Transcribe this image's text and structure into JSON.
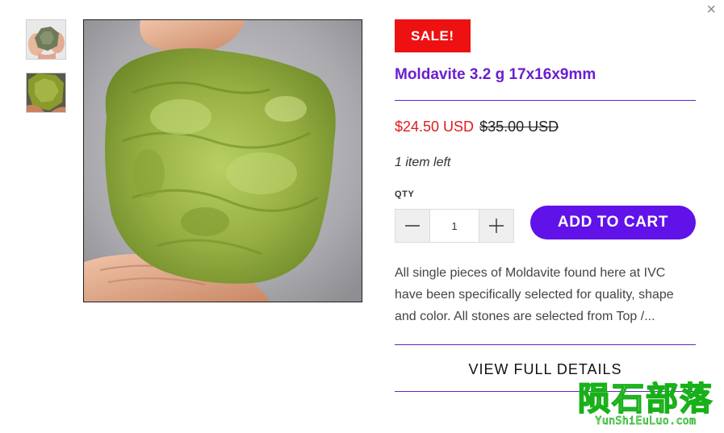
{
  "modal": {
    "close_label": "×"
  },
  "gallery": {
    "thumbnails": [
      {
        "alt": "Moldavite held between fingers, side view",
        "icon": "product-thumbnail"
      },
      {
        "alt": "Moldavite held between fingers, front view",
        "icon": "product-thumbnail"
      }
    ],
    "main_image_icon": "product-photo"
  },
  "product": {
    "badge": "SALE!",
    "title": "Moldavite 3.2 g 17x16x9mm",
    "price": "$24.50 USD",
    "compare_at_price": "$35.00 USD",
    "stock_note": "1 item left",
    "qty_label": "QTY",
    "qty_value": "1",
    "add_to_cart_label": "ADD TO CART",
    "description": "All single pieces of Moldavite found here at IVC have been specifically selected for quality, shape and color. All stones are selected from Top /...",
    "view_details_label": "VIEW FULL DETAILS"
  },
  "watermark": {
    "cn": "陨石部落",
    "en": "YunShiEuLuo.com"
  },
  "colors": {
    "accent_purple": "#6012e8",
    "title_purple": "#6a1fcf",
    "sale_red": "#ee1111",
    "price_red": "#e01b1b",
    "watermark_green": "#18b018"
  }
}
